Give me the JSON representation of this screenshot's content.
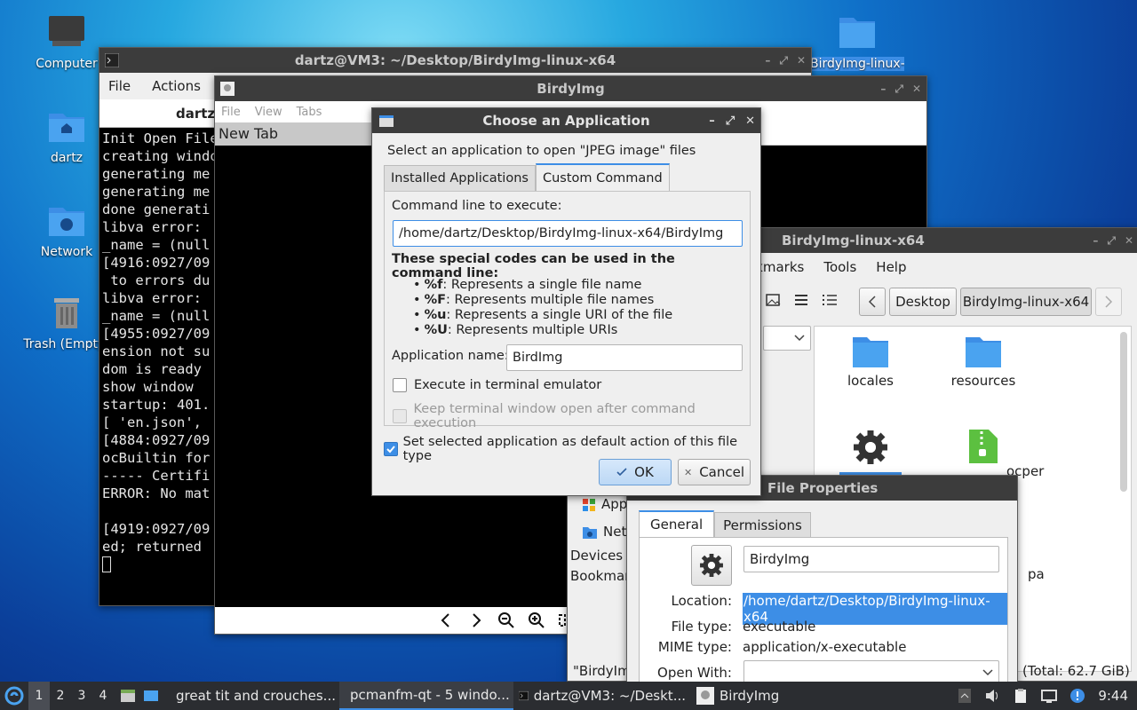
{
  "desktop": {
    "icons": [
      {
        "label": "Computer"
      },
      {
        "label": "dartz"
      },
      {
        "label": "Network"
      },
      {
        "label": "Trash (Empty)"
      },
      {
        "label": "BirdyImg-linux-"
      }
    ]
  },
  "terminal": {
    "title": "dartz@VM3: ~/Desktop/BirdyImg-linux-x64",
    "menu": [
      "File",
      "Actions"
    ],
    "tab_label": "dartz",
    "lines": [
      "Init Open File",
      "creating window",
      "generating me",
      "generating me",
      "done generati",
      "libva error:",
      "_name = (null",
      "[4916:0927/09",
      " to errors du",
      "libva error:",
      "_name = (null",
      "[4955:0927/09",
      "ension not su",
      "dom is ready",
      "show window",
      "startup: 401.",
      "[ 'en.json',",
      "[4884:0927/09",
      "ocBuiltin for",
      "----- Certifi",
      "ERROR: No mat",
      "",
      "[4919:0927/09",
      "ed; returned"
    ]
  },
  "birdyimg": {
    "title": "BirdyImg",
    "menu": [
      "File",
      "View",
      "Tabs"
    ],
    "tab": "New Tab"
  },
  "dialog": {
    "title": "Choose an Application",
    "prompt": "Select an application to open \"JPEG image\" files",
    "tabs": [
      "Installed Applications",
      "Custom Command"
    ],
    "cmd_label": "Command line to execute:",
    "cmd_value": "/home/dartz/Desktop/BirdyImg-linux-x64/BirdyImg",
    "codes_heading": "These special codes can be used in the command line:",
    "codes": [
      {
        "code": "%f",
        "desc": ": Represents a single file name"
      },
      {
        "code": "%F",
        "desc": ": Represents multiple file names"
      },
      {
        "code": "%u",
        "desc": ": Represents a single URI of the file"
      },
      {
        "code": "%U",
        "desc": ": Represents multiple URIs"
      }
    ],
    "appname_label": "Application name:",
    "appname_value": "BirdImg",
    "exec_terminal": "Execute in terminal emulator",
    "keep_open": "Keep terminal window open after command execution",
    "set_default": "Set selected application as default action of this file type",
    "ok": "OK",
    "cancel": "Cancel"
  },
  "filemanager": {
    "title": "BirdyImg-linux-x64",
    "menu": [
      "okmarks",
      "Tools",
      "Help"
    ],
    "crumbs": [
      "Desktop",
      "BirdyImg-linux-x64"
    ],
    "files": [
      "locales",
      "resources",
      "",
      "ocper"
    ],
    "side": [
      "App",
      "Net",
      "Devices",
      "Bookmar"
    ],
    "status_left": "\"BirdyIm",
    "status_right": "(Total: 62.7 GiB)",
    "partial": "pa"
  },
  "props": {
    "title": "File Properties",
    "tabs": [
      "General",
      "Permissions"
    ],
    "name": "BirdyImg",
    "location_label": "Location:",
    "location": "/home/dartz/Desktop/BirdyImg-linux-x64",
    "filetype_label": "File type:",
    "filetype": "executable",
    "mime_label": "MIME type:",
    "mime": "application/x-executable",
    "openwith_label": "Open With:"
  },
  "taskbar": {
    "workspaces": [
      "1",
      "2",
      "3",
      "4"
    ],
    "tasks": [
      "great tit and crouches...",
      "pcmanfm-qt - 5 windo...",
      "dartz@VM3: ~/Deskt...",
      "BirdyImg"
    ],
    "clock": "9:44"
  }
}
